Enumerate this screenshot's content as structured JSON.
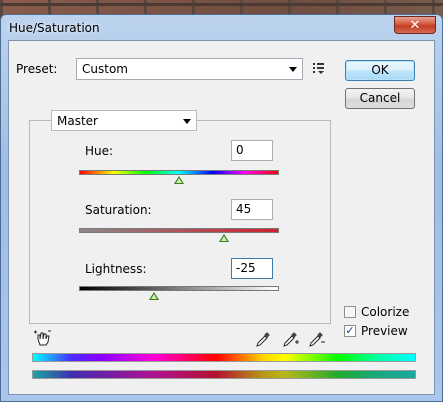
{
  "window": {
    "title": "Hue/Saturation",
    "close_glyph": "✕"
  },
  "preset": {
    "label": "Preset:",
    "value": "Custom"
  },
  "buttons": {
    "ok": "OK",
    "cancel": "Cancel"
  },
  "channel": {
    "value": "Master"
  },
  "sliders": [
    {
      "label": "Hue:",
      "value": "0",
      "range": [
        -180,
        180
      ]
    },
    {
      "label": "Saturation:",
      "value": "45",
      "range": [
        -100,
        100
      ]
    },
    {
      "label": "Lightness:",
      "value": "-25",
      "range": [
        -100,
        100
      ]
    }
  ],
  "options": {
    "colorize": {
      "label": "Colorize",
      "checked": false
    },
    "preview": {
      "label": "Preview",
      "checked": true,
      "check_glyph": "✓"
    }
  },
  "icons": {
    "preset_menu": "preset-options-icon",
    "targeted_adjust": "hand-adjust-icon",
    "eyedropper": "eyedropper-icon",
    "eyedropper_add": "eyedropper-plus-icon",
    "eyedropper_subtract": "eyedropper-minus-icon"
  },
  "colors": {
    "titlebar": "#aac6ea",
    "close": "#c23d25",
    "thumb": "#3a7a20"
  }
}
